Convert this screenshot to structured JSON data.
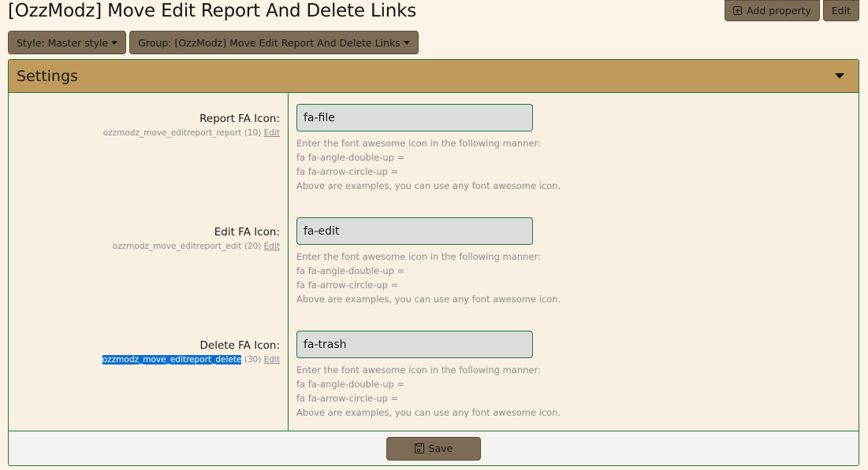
{
  "page": {
    "title": "[OzzModz] Move Edit Report And Delete Links"
  },
  "top_actions": {
    "add_property": {
      "label": "Add property",
      "icon": "plus-square-icon"
    },
    "edit": {
      "label": "Edit"
    }
  },
  "filters": {
    "style": {
      "label": "Style: Master style",
      "icon": "caret-down-icon"
    },
    "group": {
      "label": "Group: [OzzModz] Move Edit Report And Delete Links",
      "icon": "caret-down-icon"
    }
  },
  "settings_block": {
    "title": "Settings",
    "collapse_icon": "caret-down-icon",
    "rows": [
      {
        "label": "Report FA Icon:",
        "property_key": "ozzmodz_move_editreport_report",
        "order": "(10)",
        "edit_label": "Edit",
        "value": "fa-file",
        "selected": false,
        "explain": [
          "Enter the font awesome icon in the following manner:",
          "fa fa-angle-double-up =",
          "fa fa-arrow-circle-up =",
          "Above are examples, you can use any font awesome icon."
        ]
      },
      {
        "label": "Edit FA Icon:",
        "property_key": "ozzmodz_move_editreport_edit",
        "order": "(20)",
        "edit_label": "Edit",
        "value": "fa-edit",
        "selected": false,
        "explain": [
          "Enter the font awesome icon in the following manner:",
          "fa fa-angle-double-up =",
          "fa fa-arrow-circle-up =",
          "Above are examples, you can use any font awesome icon."
        ]
      },
      {
        "label": "Delete FA Icon:",
        "property_key": "ozzmodz_move_editreport_delete",
        "order": "(30)",
        "edit_label": "Edit",
        "value": "fa-trash",
        "selected": true,
        "explain": [
          "Enter the font awesome icon in the following manner:",
          "fa fa-angle-double-up =",
          "fa fa-arrow-circle-up =",
          "Above are examples, you can use any font awesome icon."
        ]
      }
    ]
  },
  "footer": {
    "save": {
      "label": "Save",
      "icon": "floppy-disk-icon"
    }
  },
  "colors": {
    "background": "#fdf3e7",
    "button": "#7d6c55",
    "header": "#bf9a5a",
    "border": "#1e7a3a",
    "input_bg": "#dcdcdc",
    "selection": "#0a6fd1"
  }
}
